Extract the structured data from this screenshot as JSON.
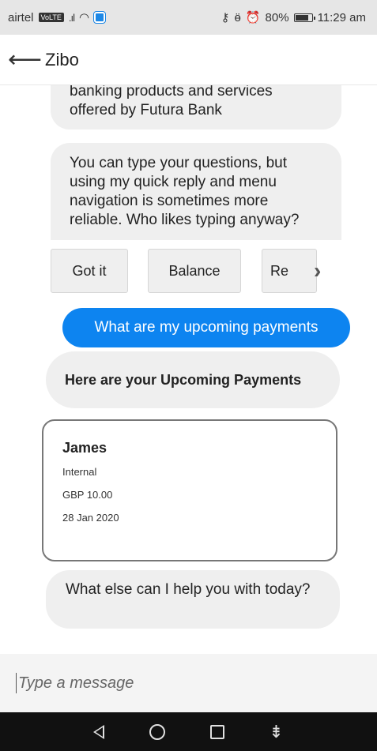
{
  "status_bar": {
    "carrier": "airtel",
    "volte": "VoLTE",
    "battery": "80%",
    "time": "11:29 am",
    "battery_level": 0.8
  },
  "header": {
    "title": "Zibo"
  },
  "chat": {
    "bot_message_1": "banking products and services offered by Futura Bank",
    "bot_message_2": "You can type your questions, but using my quick reply and menu navigation is sometimes more reliable. Who likes typing anyway?",
    "quick_replies": [
      "Got it",
      "Balance",
      "Re"
    ],
    "user_message": "What are my upcoming payments",
    "bot_heading": "Here are your Upcoming Payments",
    "payment": {
      "payee": "James",
      "type": "Internal",
      "amount": "GBP 10.00",
      "date": "28 Jan 2020"
    },
    "bot_message_last": "What else can I help you with today?"
  },
  "composer": {
    "placeholder": "Type a message"
  },
  "colors": {
    "user_bubble": "#0d84f0",
    "bot_bubble": "#efefef",
    "nav_bar": "#111111"
  },
  "icons": [
    "back-arrow-icon",
    "chevron-right-icon",
    "nav-back-icon",
    "nav-home-icon",
    "nav-recent-icon",
    "nav-notification-icon"
  ]
}
